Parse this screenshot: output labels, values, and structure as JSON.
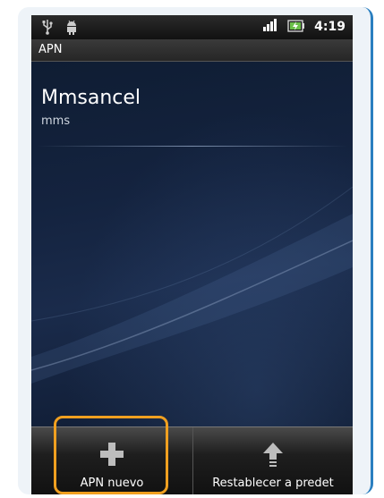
{
  "status_bar": {
    "time": "4:19",
    "icons": [
      "usb-icon",
      "android-debug-icon",
      "signal-icon",
      "battery-icon"
    ]
  },
  "title_bar": {
    "title": "APN"
  },
  "apn_list": [
    {
      "name": "Mmsancel",
      "type": "mms"
    }
  ],
  "menu": {
    "new_apn_label": "APN nuevo",
    "reset_label": "Restablecer a predet"
  },
  "colors": {
    "highlight": "#f0a020",
    "frame_accent": "#2a7fc0"
  }
}
